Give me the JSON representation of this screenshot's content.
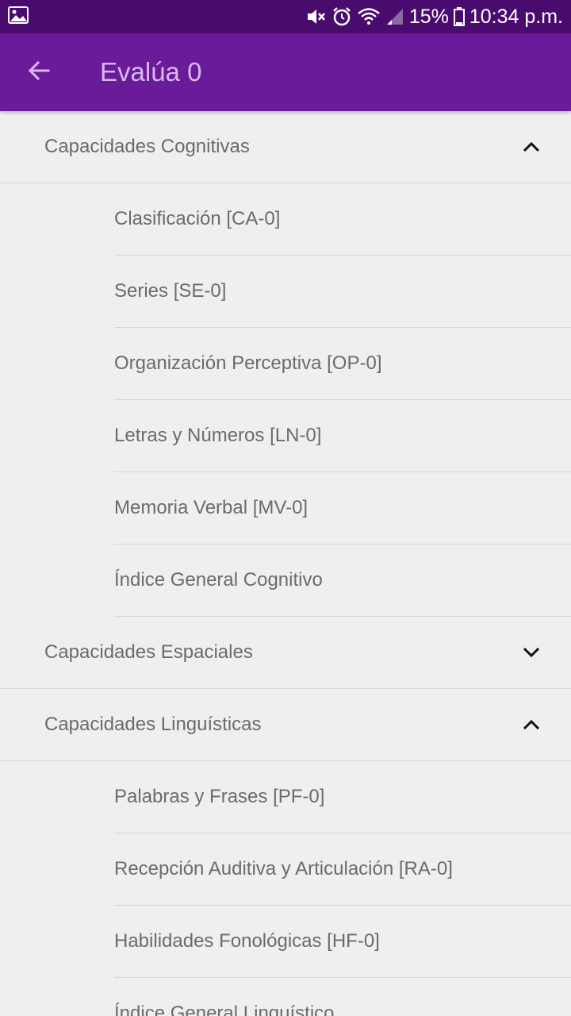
{
  "status_bar": {
    "battery": "15%",
    "time": "10:34 p.m.",
    "left_icon": "gallery-icon",
    "right_icons": [
      "mute-icon",
      "alarm-icon",
      "wifi-icon",
      "signal-icon",
      "battery-icon"
    ]
  },
  "app_bar": {
    "back_icon": "arrow-back-icon",
    "title": "Evalúa 0"
  },
  "colors": {
    "status_bar": "#4a0b6e",
    "app_bar": "#6a1b9a",
    "title_text": "#d9b8ee",
    "background": "#efefef",
    "item_text": "#6b6b6b",
    "divider": "#d6d6d6"
  },
  "groups": [
    {
      "label": "Capacidades Cognitivas",
      "expanded": true,
      "chevron": "chevron-up-icon",
      "items": [
        "Clasificación [CA-0]",
        "Series [SE-0]",
        "Organización Perceptiva [OP-0]",
        "Letras y Números [LN-0]",
        "Memoria Verbal [MV-0]",
        "Índice General Cognitivo"
      ]
    },
    {
      "label": "Capacidades Espaciales",
      "expanded": false,
      "chevron": "chevron-down-icon",
      "items": []
    },
    {
      "label": "Capacidades Linguísticas",
      "expanded": true,
      "chevron": "chevron-up-icon",
      "items": [
        "Palabras y Frases [PF-0]",
        "Recepción Auditiva y Articulación [RA-0]",
        "Habilidades Fonológicas [HF-0]",
        "Índice General Linguístico"
      ]
    }
  ]
}
